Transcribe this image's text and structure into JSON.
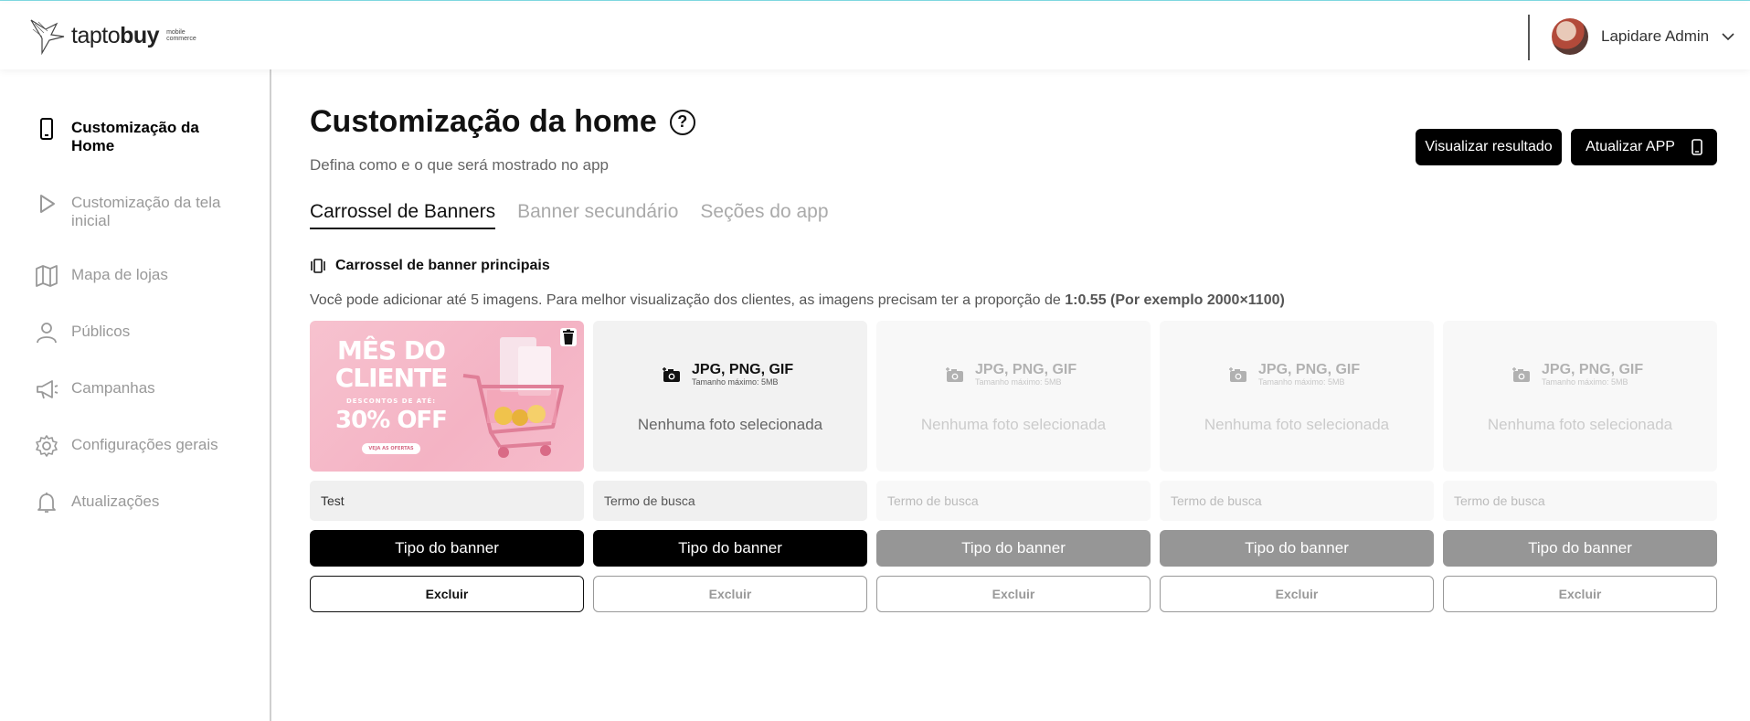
{
  "header": {
    "logo_word_light": "tapto",
    "logo_word_bold": "buy",
    "logo_sub_1": "mobile",
    "logo_sub_2": "commerce",
    "user_name": "Lapidare Admin"
  },
  "sidebar": {
    "items": [
      {
        "label": "Customização da Home",
        "icon": "phone-icon",
        "active": true
      },
      {
        "label": "Customização da tela inicial",
        "icon": "play-icon",
        "active": false
      },
      {
        "label": "Mapa de lojas",
        "icon": "map-icon",
        "active": false
      },
      {
        "label": "Públicos",
        "icon": "person-icon",
        "active": false
      },
      {
        "label": "Campanhas",
        "icon": "megaphone-icon",
        "active": false
      },
      {
        "label": "Configurações gerais",
        "icon": "gear-icon",
        "active": false
      },
      {
        "label": "Atualizações",
        "icon": "bell-icon",
        "active": false
      }
    ]
  },
  "page": {
    "title": "Customização da home",
    "help": "?",
    "subtitle": "Defina como e o que será mostrado no app",
    "preview_button": "Visualizar resultado",
    "update_button": "Atualizar APP"
  },
  "tabs": [
    "Carrossel de Banners",
    "Banner secundário",
    "Seções do app"
  ],
  "section": {
    "title": "Carrossel de banner principais",
    "info_prefix": "Você pode adicionar até 5 imagens. Para melhor visualização dos clientes, as imagens precisam ter a proporção de ",
    "info_bold": "1:0.55 (Por exemplo 2000×1100)"
  },
  "banner_image": {
    "line1": "MÊS DO",
    "line2": "CLIENTE",
    "line3": "DESCONTOS DE ATÉ:",
    "line4": "30% OFF",
    "cta": "VEJA AS OFERTAS"
  },
  "upload": {
    "formats": "JPG, PNG, GIF",
    "max_size": "Tamanho máximo: 5MB",
    "empty": "Nenhuma foto selecionada"
  },
  "slots": [
    {
      "field_value": "Test",
      "field_placeholder": "",
      "type_label": "Tipo do banner",
      "delete_label": "Excluir"
    },
    {
      "field_value": "",
      "field_placeholder": "Termo de busca",
      "type_label": "Tipo do banner",
      "delete_label": "Excluir"
    },
    {
      "field_value": "",
      "field_placeholder": "Termo de busca",
      "type_label": "Tipo do banner",
      "delete_label": "Excluir"
    },
    {
      "field_value": "",
      "field_placeholder": "Termo de busca",
      "type_label": "Tipo do banner",
      "delete_label": "Excluir"
    },
    {
      "field_value": "",
      "field_placeholder": "Termo de busca",
      "type_label": "Tipo do banner",
      "delete_label": "Excluir"
    }
  ],
  "colors": {
    "accent": "#000000",
    "topline": "#7fd8e0",
    "disabled": "#969696"
  }
}
